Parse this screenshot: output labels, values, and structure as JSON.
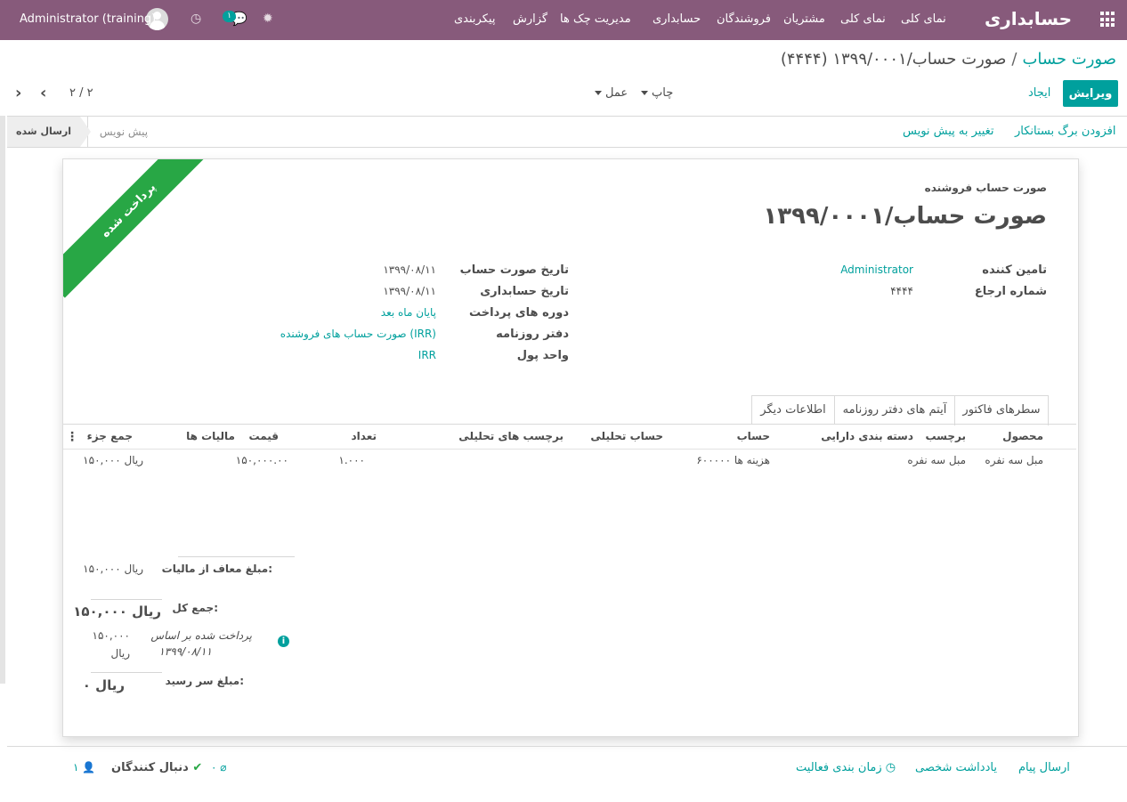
{
  "topbar": {
    "app_title": "حسابداری",
    "menu": [
      "نمای کلی",
      "نمای کلی",
      "مشتریان",
      "فروشندگان",
      "حسابداری",
      "مدیریت چک ها",
      "گزارش",
      "پیکربندی"
    ],
    "user": "Administrator (training)",
    "message_count": "۱"
  },
  "breadcrumb": {
    "parent": "صورت حساب",
    "separator": "/",
    "current": "صورت حساب/۱۳۹۹/۰۰۰۱ (۴۴۴۴)"
  },
  "controls": {
    "edit": "ویرایش",
    "create": "ایجاد",
    "print": "چاپ",
    "action": "عمل",
    "pager": "۲ / ۲"
  },
  "statusbar": {
    "add_credit_note": "افزودن برگ بستانکار",
    "reset_to_draft": "تغییر به پیش نویس",
    "stage_draft": "پیش نویس",
    "stage_posted": "ارسال شده"
  },
  "sheet": {
    "ribbon": "پرداخت شده",
    "move_type": "صورت حساب فروشنده",
    "name": "صورت حساب/۱۳۹۹/۰۰۰۱",
    "left_fields": [
      {
        "label": "تامین کننده",
        "value": "Administrator",
        "link": true
      },
      {
        "label": "شماره ارجاع",
        "value": "۴۴۴۴",
        "link": false
      }
    ],
    "right_fields": [
      {
        "label": "تاریخ صورت حساب",
        "value": "۱۳۹۹/۰۸/۱۱",
        "link": false
      },
      {
        "label": "تاریخ حسابداری",
        "value": "۱۳۹۹/۰۸/۱۱",
        "link": false
      },
      {
        "label": "دوره های پرداخت",
        "value": "پایان ماه بعد",
        "link": true
      },
      {
        "label": "دفتر روزنامه",
        "value": "صورت حساب های فروشنده (IRR)",
        "link": true
      },
      {
        "label": "واحد پول",
        "value": "IRR",
        "link": true
      }
    ]
  },
  "tabs": [
    "سطرهای فاکتور",
    "آیتم های دفتر روزنامه",
    "اطلاعات دیگر"
  ],
  "table": {
    "headers": [
      "محصول",
      "برچسب",
      "دسته بندی دارایی",
      "حساب",
      "حساب تحلیلی",
      "برچسب های تحلیلی",
      "تعداد",
      "قیمت",
      "مالیات ها",
      "جمع جزء"
    ],
    "rows": [
      [
        "مبل سه نفره",
        "مبل سه نفره",
        "",
        "۶۰۰۰۰۰ هزینه ها",
        "",
        "",
        "۱.۰۰۰",
        "۱۵۰,۰۰۰.۰۰",
        "",
        "۱۵۰,۰۰۰ ریال"
      ]
    ]
  },
  "totals": {
    "untaxed_label": "مبلغ معاف از مالیات:",
    "untaxed_value": "۱۵۰,۰۰۰ ریال",
    "total_label": "جمع کل:",
    "total_value": "۱۵۰,۰۰۰ ریال",
    "paid_label_1": "پرداخت شده بر اساس",
    "paid_label_2": "۱۳۹۹/۰۸/۱۱",
    "paid_amount_1": "۱۵۰,۰۰۰",
    "paid_amount_2": "ریال",
    "due_label": "مبلغ سر رسید:",
    "due_value": "۰ ریال"
  },
  "chatter": {
    "send_message": "ارسال پیام",
    "log_note": "یادداشت شخصی",
    "schedule_activity": "زمان بندی فعالیت",
    "attachments": "۰",
    "followers_label": "دنبال کنندگان",
    "followers_count": "۱"
  },
  "colors": {
    "brand": "#875a7b",
    "accent": "#00a09d",
    "ribbon": "#28a745"
  }
}
